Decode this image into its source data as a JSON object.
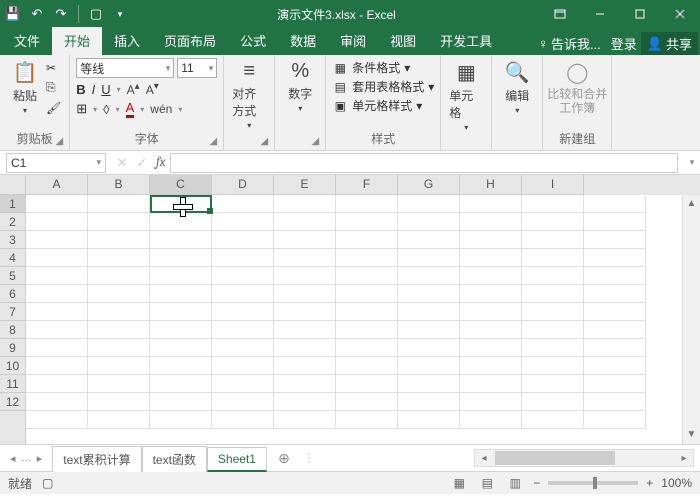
{
  "title": "演示文件3.xlsx - Excel",
  "tabs": {
    "file": "文件",
    "home": "开始",
    "insert": "插入",
    "layout": "页面布局",
    "formulas": "公式",
    "data": "数据",
    "review": "审阅",
    "view": "视图",
    "dev": "开发工具"
  },
  "tellme": "告诉我...",
  "login": "登录",
  "share": "共享",
  "groups": {
    "clipboard": "剪贴板",
    "font": "字体",
    "align": "对齐方式",
    "number": "数字",
    "styles": "样式",
    "cells": "单元格",
    "editing": "编辑",
    "newgrp": "新建组",
    "compare": "比较和合并\n工作簿"
  },
  "font": {
    "name": "等线",
    "size": "11"
  },
  "fontbtns": {
    "bold": "B",
    "italic": "I",
    "underline": "U",
    "a1": "A",
    "a2": "A",
    "wen": "wén"
  },
  "cond": {
    "cf": "条件格式",
    "tbl": "套用表格格式",
    "cs": "单元格样式"
  },
  "paste": "粘贴",
  "active_cell": "C1",
  "cols": [
    "A",
    "B",
    "C",
    "D",
    "E",
    "F",
    "G",
    "H",
    "I"
  ],
  "rows": [
    "1",
    "2",
    "3",
    "4",
    "5",
    "6",
    "7",
    "8",
    "9",
    "10",
    "11",
    "12"
  ],
  "sheets": {
    "nav": "...",
    "s1": "text累积计算",
    "s2": "text函数",
    "s3": "Sheet1"
  },
  "status": {
    "ready": "就绪",
    "rec": "",
    "zoom": "100%"
  }
}
